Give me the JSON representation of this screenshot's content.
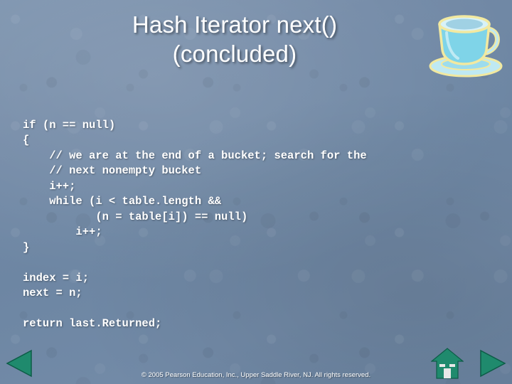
{
  "slide": {
    "title_line1": "Hash Iterator next()",
    "title_line2": "(concluded)",
    "code": "if (n == null)\n{\n    // we are at the end of a bucket; search for the\n    // next nonempty bucket\n    i++;\n    while (i < table.length &&\n           (n = table[i]) == null)\n        i++;\n}\n\nindex = i;\nnext = n;\n\nreturn last.Returned;",
    "closing_brace": "}",
    "copyright": "© 2005 Pearson Education, Inc., Upper Saddle River, NJ.  All rights reserved."
  },
  "nav": {
    "prev_label": "previous-slide",
    "next_label": "next-slide",
    "home_label": "home"
  },
  "colors": {
    "background": "#7289a6",
    "text": "#ffffff",
    "nav_green": "#1f8a6d",
    "cup_body": "#7fd4e8",
    "cup_outline": "#f2e9a0"
  }
}
